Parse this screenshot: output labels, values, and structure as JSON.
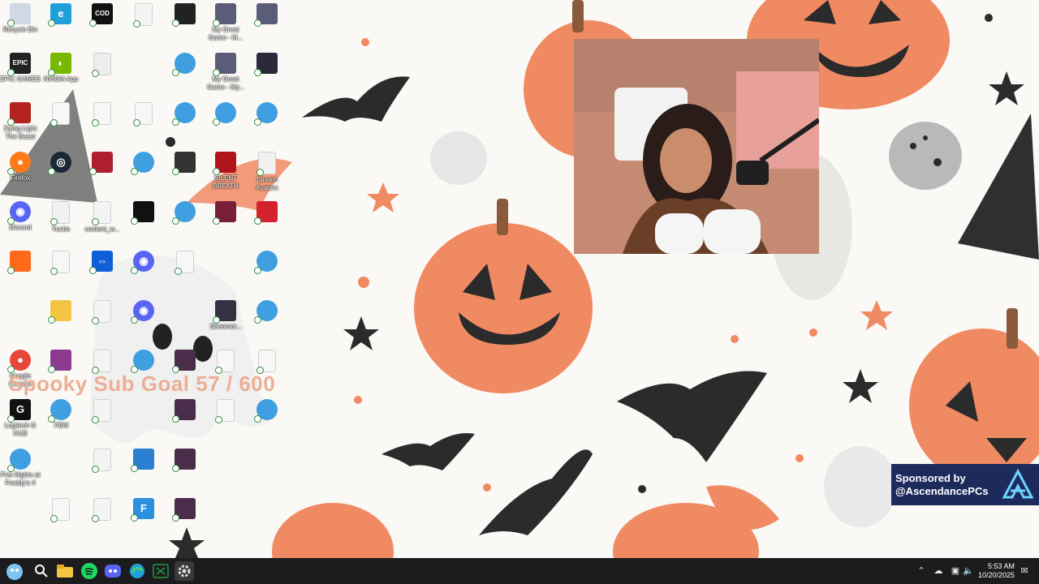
{
  "desktop": {
    "overlay": {
      "sub_goal": "Spooky Sub Goal 57 / 600"
    },
    "sponsor": {
      "line1": "Sponsored by",
      "line2": "@AscendancePCs"
    },
    "icons": [
      {
        "label": "Recycle Bin",
        "icon": "recycle-bin-icon"
      },
      {
        "label": "",
        "icon": "edge-icon"
      },
      {
        "label": "",
        "icon": "call-of-duty-icon"
      },
      {
        "label": "",
        "icon": "video-file-icon"
      },
      {
        "label": "",
        "icon": "crosshair-app-icon"
      },
      {
        "label": "My Great Game - M...",
        "icon": "game-shortcut-icon"
      },
      {
        "label": "",
        "icon": "game-shortcut-icon"
      },
      {
        "label": "EPIC GAMES",
        "icon": "epic-games-icon"
      },
      {
        "label": "NVIDIA App",
        "icon": "nvidia-icon"
      },
      {
        "label": "",
        "icon": "settings-file-icon"
      },
      {
        "label": "",
        "icon": "globe-shortcut-icon"
      },
      {
        "label": "My Great Game - My...",
        "icon": "game-shortcut-icon"
      },
      {
        "label": "",
        "icon": "streamer-bot-icon"
      },
      {
        "label": "Dying Light The Beast",
        "icon": "dying-light-icon"
      },
      {
        "label": "",
        "icon": "blank-file-icon"
      },
      {
        "label": "",
        "icon": "config-file-icon"
      },
      {
        "label": "",
        "icon": "blank-file-icon"
      },
      {
        "label": "",
        "icon": "globe-shortcut-icon"
      },
      {
        "label": "",
        "icon": "globe-shortcut-icon"
      },
      {
        "label": "",
        "icon": "globe-shortcut-icon"
      },
      {
        "label": "Firefox",
        "icon": "firefox-icon"
      },
      {
        "label": "",
        "icon": "steam-icon"
      },
      {
        "label": "",
        "icon": "streamlabs-icon"
      },
      {
        "label": "",
        "icon": "globe-shortcut-icon"
      },
      {
        "label": "",
        "icon": "phone-link-icon"
      },
      {
        "label": "SILENT BREATH",
        "icon": "silent-breath-icon"
      },
      {
        "label": "Stream Avatars",
        "icon": "stream-avatars-icon"
      },
      {
        "label": "Discord",
        "icon": "discord-icon"
      },
      {
        "label": "Yunite",
        "icon": "yunite-icon"
      },
      {
        "label": "content_w...",
        "icon": "video-file-icon"
      },
      {
        "label": "",
        "icon": "dark-app-icon"
      },
      {
        "label": "",
        "icon": "globe-shortcut-icon"
      },
      {
        "label": "",
        "icon": "framer-icon"
      },
      {
        "label": "",
        "icon": "fist-app-icon"
      },
      {
        "label": "",
        "icon": "sound-app-icon"
      },
      {
        "label": "",
        "icon": "blank-file-icon"
      },
      {
        "label": "",
        "icon": "teamviewer-icon"
      },
      {
        "label": "",
        "icon": "discord-icon"
      },
      {
        "label": "",
        "icon": "window-file-icon"
      },
      {
        "label": "",
        "icon": "globe-shortcut-icon"
      },
      {
        "label": "",
        "icon": "folder-icon"
      },
      {
        "label": "",
        "icon": "video-file-icon"
      },
      {
        "label": "",
        "icon": "discord-icon"
      },
      {
        "label": "Streamer...",
        "icon": "streamer-app-icon"
      },
      {
        "label": "",
        "icon": "globe-shortcut-icon"
      },
      {
        "label": "Google Chrome",
        "icon": "chrome-icon"
      },
      {
        "label": "",
        "icon": "image-file-icon"
      },
      {
        "label": "",
        "icon": "video-file-icon"
      },
      {
        "label": "",
        "icon": "globe-shortcut-icon"
      },
      {
        "label": "",
        "icon": "image-thumb-icon"
      },
      {
        "label": "",
        "icon": "blank-file-icon"
      },
      {
        "label": "",
        "icon": "blank-file-icon"
      },
      {
        "label": "Logitech G HUB",
        "icon": "logitech-icon"
      },
      {
        "label": "7IBM",
        "icon": "globe-shortcut-icon"
      },
      {
        "label": "",
        "icon": "video-file-icon"
      },
      {
        "label": "",
        "icon": "image-thumb-icon"
      },
      {
        "label": "",
        "icon": "blank-file-icon"
      },
      {
        "label": "",
        "icon": "globe-shortcut-icon"
      },
      {
        "label": "Five Nights at Freddy's 4",
        "icon": "fnaf-icon"
      },
      {
        "label": "",
        "icon": "video-file-icon"
      },
      {
        "label": "",
        "icon": "document-icon"
      },
      {
        "label": "",
        "icon": "image-thumb-icon"
      },
      {
        "label": "",
        "icon": "blank-file-icon"
      },
      {
        "label": "",
        "icon": "video-file-icon"
      },
      {
        "label": "",
        "icon": "f-app-icon"
      },
      {
        "label": "",
        "icon": "image-thumb-icon"
      }
    ]
  },
  "taskbar": {
    "apps": [
      {
        "icon": "start-mascot-icon"
      },
      {
        "icon": "search-icon"
      },
      {
        "icon": "file-explorer-icon"
      },
      {
        "icon": "spotify-icon"
      },
      {
        "icon": "discord-icon"
      },
      {
        "icon": "edge-icon"
      },
      {
        "icon": "xbox-icon"
      },
      {
        "icon": "settings-gear-icon"
      }
    ],
    "time": "5:53 AM",
    "date": "10/20/2025"
  },
  "colors": {
    "pumpkin": "#f08a63",
    "bat": "#2b2b2b",
    "taskbar": "#1c1c1e",
    "sponsor_bg": "#1d2a5c",
    "goal_text": "#ecae94"
  }
}
